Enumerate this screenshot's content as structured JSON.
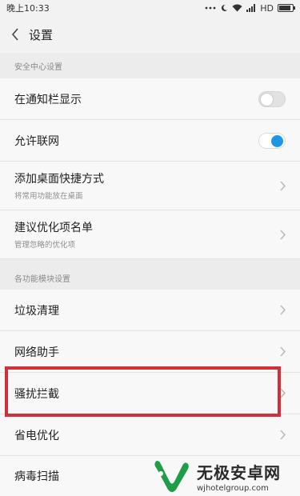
{
  "status_bar": {
    "time": "晚上10:33",
    "network": "HD",
    "battery_level": 0.85
  },
  "nav": {
    "title": "设置"
  },
  "sections": {
    "security": {
      "header": "安全中心设置"
    },
    "modules": {
      "header": "各功能模块设置"
    }
  },
  "security_items": [
    {
      "title": "在通知栏显示",
      "toggle": "off"
    },
    {
      "title": "允许联网",
      "toggle": "on"
    },
    {
      "title": "添加桌面快捷方式",
      "subtitle": "将常用功能放在桌面"
    },
    {
      "title": "建议优化项名单",
      "subtitle": "管理忽略的优化项"
    }
  ],
  "module_items": [
    {
      "title": "垃圾清理"
    },
    {
      "title": "网络助手"
    },
    {
      "title": "骚扰拦截"
    },
    {
      "title": "省电优化"
    },
    {
      "title": "病毒扫描"
    }
  ],
  "colors": {
    "highlight": "#d0303a",
    "toggle_on": "#1e96e8",
    "watermark_logo": "#1f9e4a"
  },
  "watermark": {
    "name": "无极安卓网",
    "url": "wjhotelgroup.com"
  }
}
